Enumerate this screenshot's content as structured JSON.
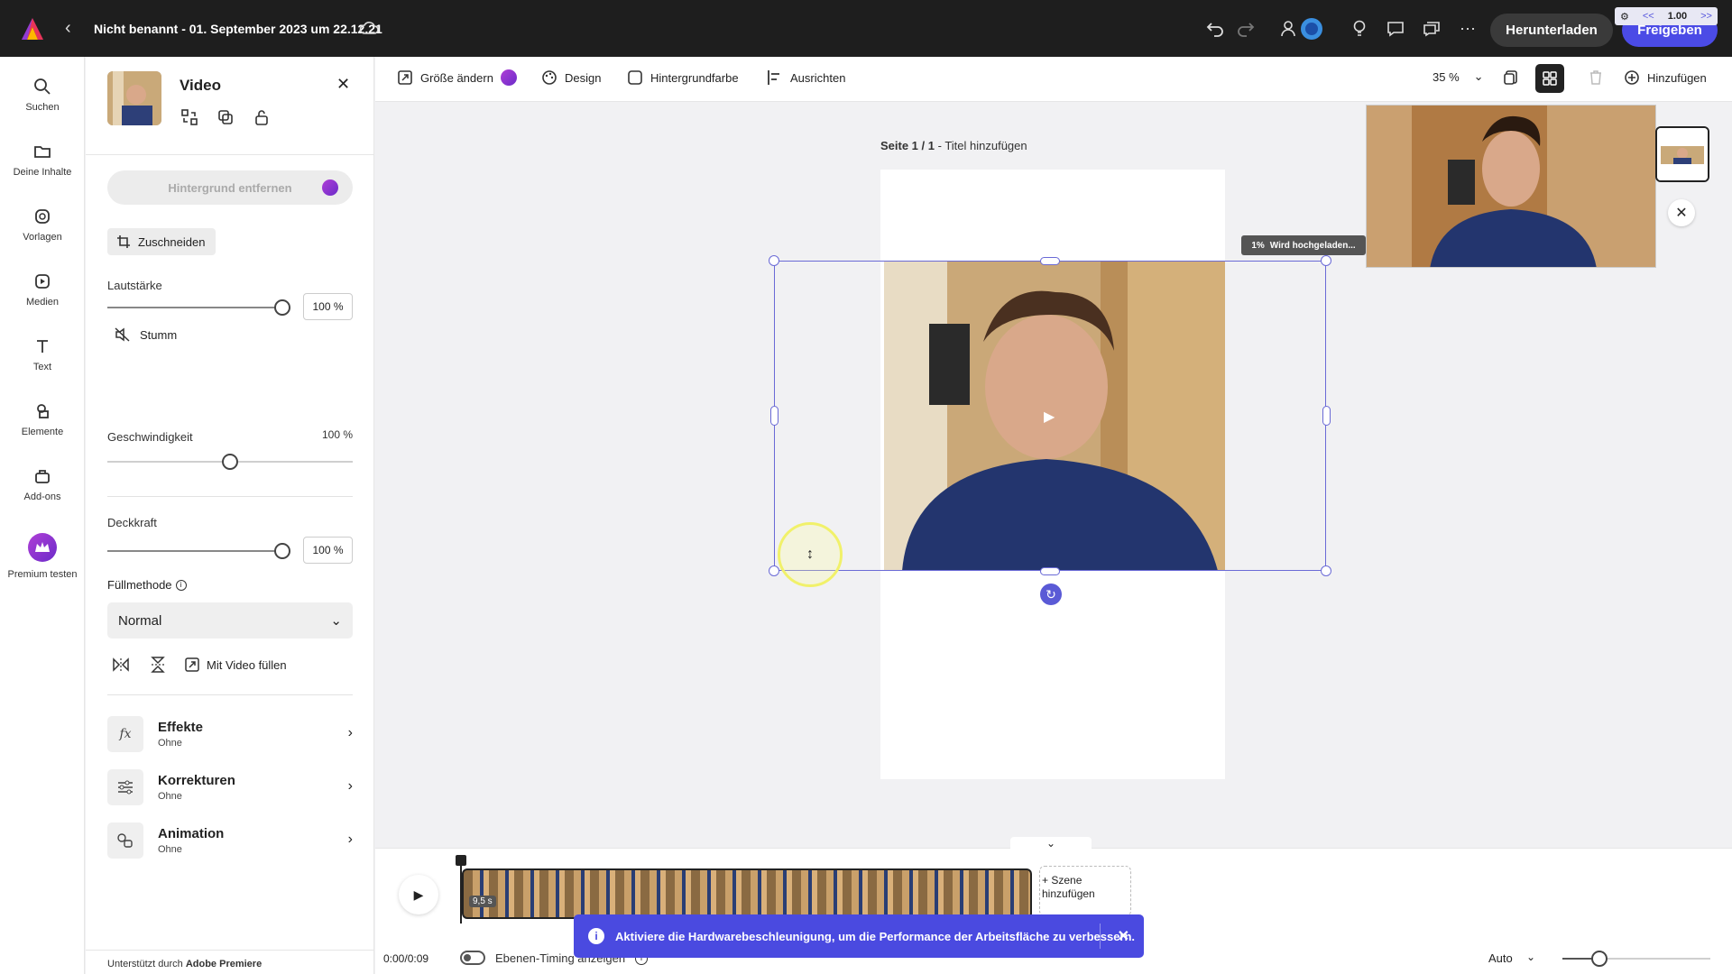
{
  "app": {
    "doc_title": "Nicht benannt - 01. September 2023 um 22.12.21",
    "download_label": "Herunterladen",
    "share_label": "Freigeben",
    "speed_value": "1.00",
    "speed_prev": "<<",
    "speed_next": ">>",
    "accent_color": "#4b4be6"
  },
  "rail": {
    "items": [
      {
        "label": "Suchen",
        "icon": "search-icon"
      },
      {
        "label": "Deine Inhalte",
        "icon": "folder-icon"
      },
      {
        "label": "Vorlagen",
        "icon": "templates-icon"
      },
      {
        "label": "Medien",
        "icon": "media-icon"
      },
      {
        "label": "Text",
        "icon": "text-icon"
      },
      {
        "label": "Elemente",
        "icon": "elements-icon"
      },
      {
        "label": "Add-ons",
        "icon": "addons-icon"
      },
      {
        "label": "Premium testen",
        "icon": "crown-icon"
      }
    ]
  },
  "panel": {
    "title": "Video",
    "bg_remove_label": "Hintergrund entfernen",
    "crop_label": "Zuschneiden",
    "volume_label": "Lautstärke",
    "volume_value": "100 %",
    "volume_level": 1.0,
    "mute_label": "Stumm",
    "speed_label": "Geschwindigkeit",
    "speed_value": "100 %",
    "speed_level": 0.5,
    "opacity_label": "Deckkraft",
    "opacity_value": "100 %",
    "opacity_level": 1.0,
    "blend_label": "Füllmethode",
    "blend_value": "Normal",
    "fill_video_label": "Mit Video füllen",
    "sections": [
      {
        "title": "Effekte",
        "sub": "Ohne",
        "icon": "fx-icon"
      },
      {
        "title": "Korrekturen",
        "sub": "Ohne",
        "icon": "adjustments-icon"
      },
      {
        "title": "Animation",
        "sub": "Ohne",
        "icon": "animation-icon"
      }
    ],
    "footer_prefix": "Unterstützt durch",
    "footer_brand": "Adobe Premiere"
  },
  "toolbar": {
    "resize_label": "Größe ändern",
    "design_label": "Design",
    "bgcolor_label": "Hintergrundfarbe",
    "align_label": "Ausrichten",
    "zoom_value": "35 %",
    "add_label": "Hinzufügen"
  },
  "canvas": {
    "page_prefix": "Seite 1 / 1",
    "page_title_placeholder": "Titel hinzufügen",
    "upload_percent": "1%",
    "upload_label": "Wird hochgeladen..."
  },
  "timeline": {
    "clip_duration": "9,5 s",
    "add_scene_label": "+ Szene hinzufügen",
    "time_readout": "0:00/0:09",
    "timing_label": "Ebenen-Timing anzeigen",
    "zoom_mode": "Auto",
    "zoom_level": 0.25
  },
  "toast": {
    "message": "Aktiviere die Hardwarebeschleunigung, um die Performance der Arbeitsfläche zu verbessern."
  }
}
